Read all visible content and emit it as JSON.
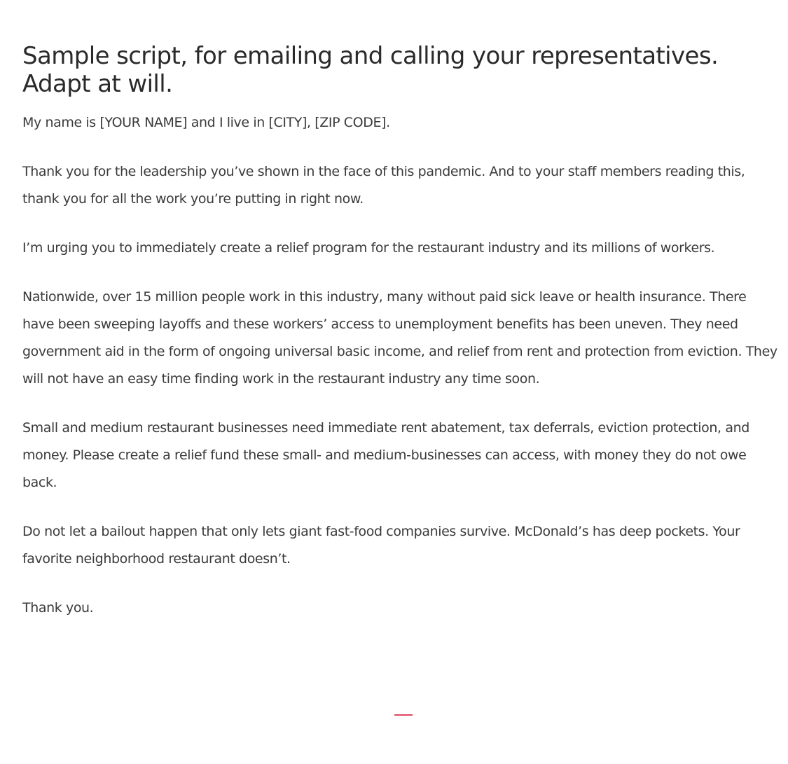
{
  "title": "Sample script, for emailing and calling your representatives. Adapt at will.",
  "paragraphs": [
    "My name is [YOUR NAME] and I live in [CITY], [ZIP CODE].",
    "Thank you for the leadership you’ve shown in the face of this pandemic. And to your staff members reading this, thank you for all the work you’re putting in right now.",
    "I’m urging you to immediately create a relief program for the restaurant industry and its millions of workers.",
    "Nationwide, over 15 million people work in this industry, many without paid sick leave or health insurance. There have been sweeping layoffs and these workers’ access to unemployment benefits has been uneven. They need government aid in the form of ongoing universal basic income, and relief from rent and protection from eviction. They will not have an easy time finding work in the restaurant industry any time soon.",
    "Small and medium restaurant businesses need immediate rent abatement, tax deferrals, eviction protection, and money. Please create a relief fund these small- and medium-businesses can access, with money they do not owe back.",
    "Do not let a bailout happen that only lets giant fast-food companies survive. McDonald’s has deep pockets. Your favorite neighborhood restaurant doesn’t.",
    "Thank you."
  ],
  "colors": {
    "text": "#3a3a3a",
    "accent_divider": "#e0485f"
  }
}
